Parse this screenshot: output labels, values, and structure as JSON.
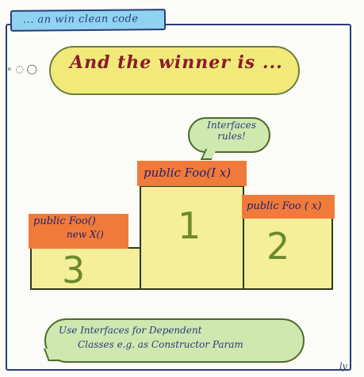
{
  "tab": {
    "label": "... an win clean code"
  },
  "decor": {
    "bubbles": "∘ ◌ ◯"
  },
  "headline": {
    "text": "And the winner is ..."
  },
  "callout": {
    "line1": "Interfaces",
    "line2": "rules!"
  },
  "podium": {
    "first": {
      "rank": "1",
      "sign": "public Foo(I x)"
    },
    "second": {
      "rank": "2",
      "sign": "public Foo ( x)"
    },
    "third": {
      "rank": "3",
      "sign_line1": "public Foo()",
      "sign_line2": "new X()"
    }
  },
  "note": {
    "line1": "Use Interfaces for Dependent",
    "line2": "Classes e.g. as Constructor Param"
  },
  "signature": "ly",
  "colors": {
    "frame": "#2a3c7a",
    "tab_fill": "#8fd3f0",
    "podium_fill": "#f4ef98",
    "sign_fill": "#f07a3a",
    "headline": "#8a1a2a",
    "bubble_fill": "#cfe8b0"
  }
}
